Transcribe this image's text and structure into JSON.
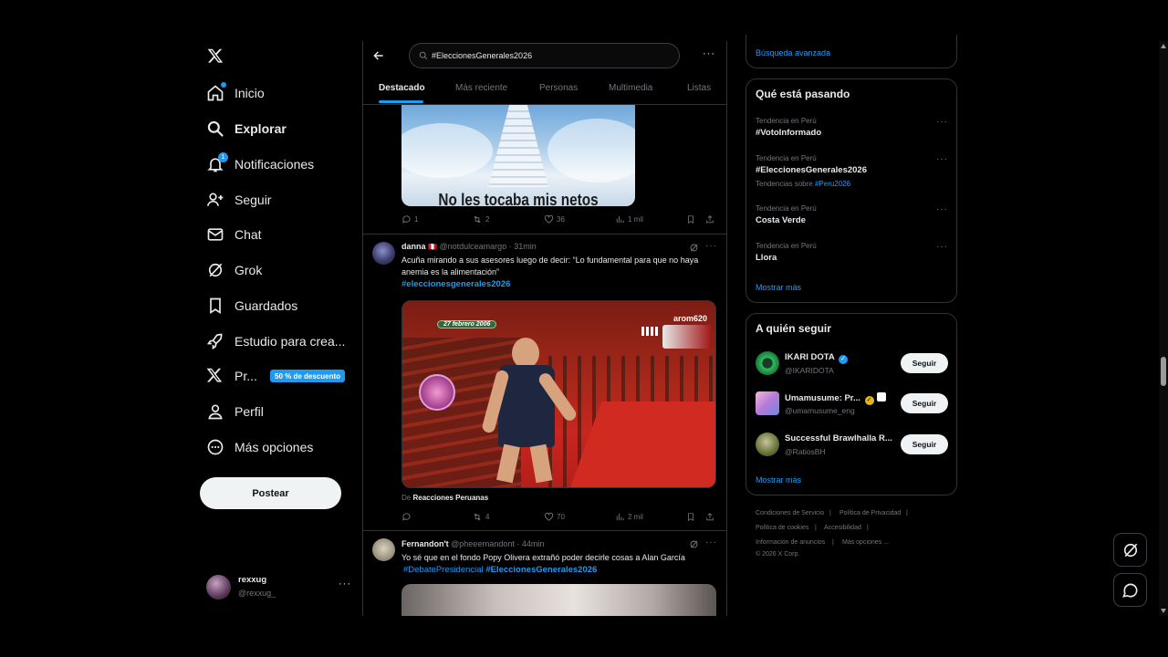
{
  "nav": {
    "items": [
      {
        "label": "Inicio",
        "icon": "home-icon"
      },
      {
        "label": "Explorar",
        "icon": "search-icon"
      },
      {
        "label": "Notificaciones",
        "icon": "bell-icon",
        "badge": "1"
      },
      {
        "label": "Seguir",
        "icon": "person-add-icon"
      },
      {
        "label": "Chat",
        "icon": "mail-icon"
      },
      {
        "label": "Grok",
        "icon": "grok-icon"
      },
      {
        "label": "Guardados",
        "icon": "bookmark-icon"
      },
      {
        "label": "Estudio para crea...",
        "icon": "rocket-icon"
      },
      {
        "label": "Pr...",
        "icon": "x-logo-icon",
        "badge": "50 % de descuento"
      },
      {
        "label": "Perfil",
        "icon": "person-icon"
      },
      {
        "label": "Más opciones",
        "icon": "more-circle-icon"
      }
    ],
    "post_label": "Postear",
    "account": {
      "name": "rexxug",
      "handle": "@rexxug_"
    }
  },
  "search": {
    "query": "#EleccionesGenerales2026",
    "tabs": [
      "Destacado",
      "Más reciente",
      "Personas",
      "Multimedia",
      "Listas"
    ],
    "active_tab": "Destacado"
  },
  "tweets": [
    {
      "image_caption": "No les tocaba mis netos",
      "replies": "1",
      "reposts": "2",
      "likes": "36",
      "views": "1 mil"
    },
    {
      "name": "danna",
      "flag": "🇵🇪",
      "handle": "@notdulceamargo",
      "time": "31min",
      "text": "Acuña mirando a sus asesores luego de decir: “Lo fundamental para que no haya anemia es la alimentación”",
      "hashtag": "#eleccionesgenerales2026",
      "video_overlay_date": "27 febrero 2006",
      "video_overlay_brand": "arom620",
      "source_prefix": "De",
      "source_name": "Reacciones Peruanas",
      "replies": "",
      "reposts": "4",
      "likes": "70",
      "views": "2 mil"
    },
    {
      "name": "Fernandon't",
      "handle": "@pheeernandont",
      "time": "44min",
      "text": "Yo sé que en el fondo Popy Olivera extrañó poder decirle cosas a Alan García",
      "hashtag1": "#DebatePresidencial",
      "hashtag2": "#EleccionesGenerales2026"
    }
  ],
  "right": {
    "advanced_search": "Búsqueda avanzada",
    "trends_title": "Qué está pasando",
    "trends": [
      {
        "context": "Tendencia en Perú",
        "title": "#VotoInformado"
      },
      {
        "context": "Tendencia en Perú",
        "title": "#EleccionesGenerales2026",
        "related_prefix": "Tendencias sobre",
        "related": "#Peru2026"
      },
      {
        "context": "Tendencia en Perú",
        "title": "Costa Verde"
      },
      {
        "context": "Tendencia en Perú",
        "title": "Llora"
      }
    ],
    "show_more": "Mostrar más",
    "who_title": "A quién seguir",
    "who": [
      {
        "name": "IKARI DOTA",
        "handle": "@IKARIDOTA"
      },
      {
        "name": "Umamusume: Pr...",
        "handle": "@umamusume_eng"
      },
      {
        "name": "Successful Brawlhalla R...",
        "handle": "@RatiosBH"
      }
    ],
    "follow_label": "Seguir",
    "who_show_more": "Mostrar más",
    "footer": [
      "Condiciones de Servicio",
      "Política de Privacidad",
      "Política de cookies",
      "Accesibilidad",
      "Información de anuncios",
      "Más opciones ...",
      "© 2026 X Corp."
    ]
  },
  "colors": {
    "accent": "#1d9bf0",
    "background": "#000000",
    "border": "#2f3336",
    "muted": "#71767b"
  }
}
